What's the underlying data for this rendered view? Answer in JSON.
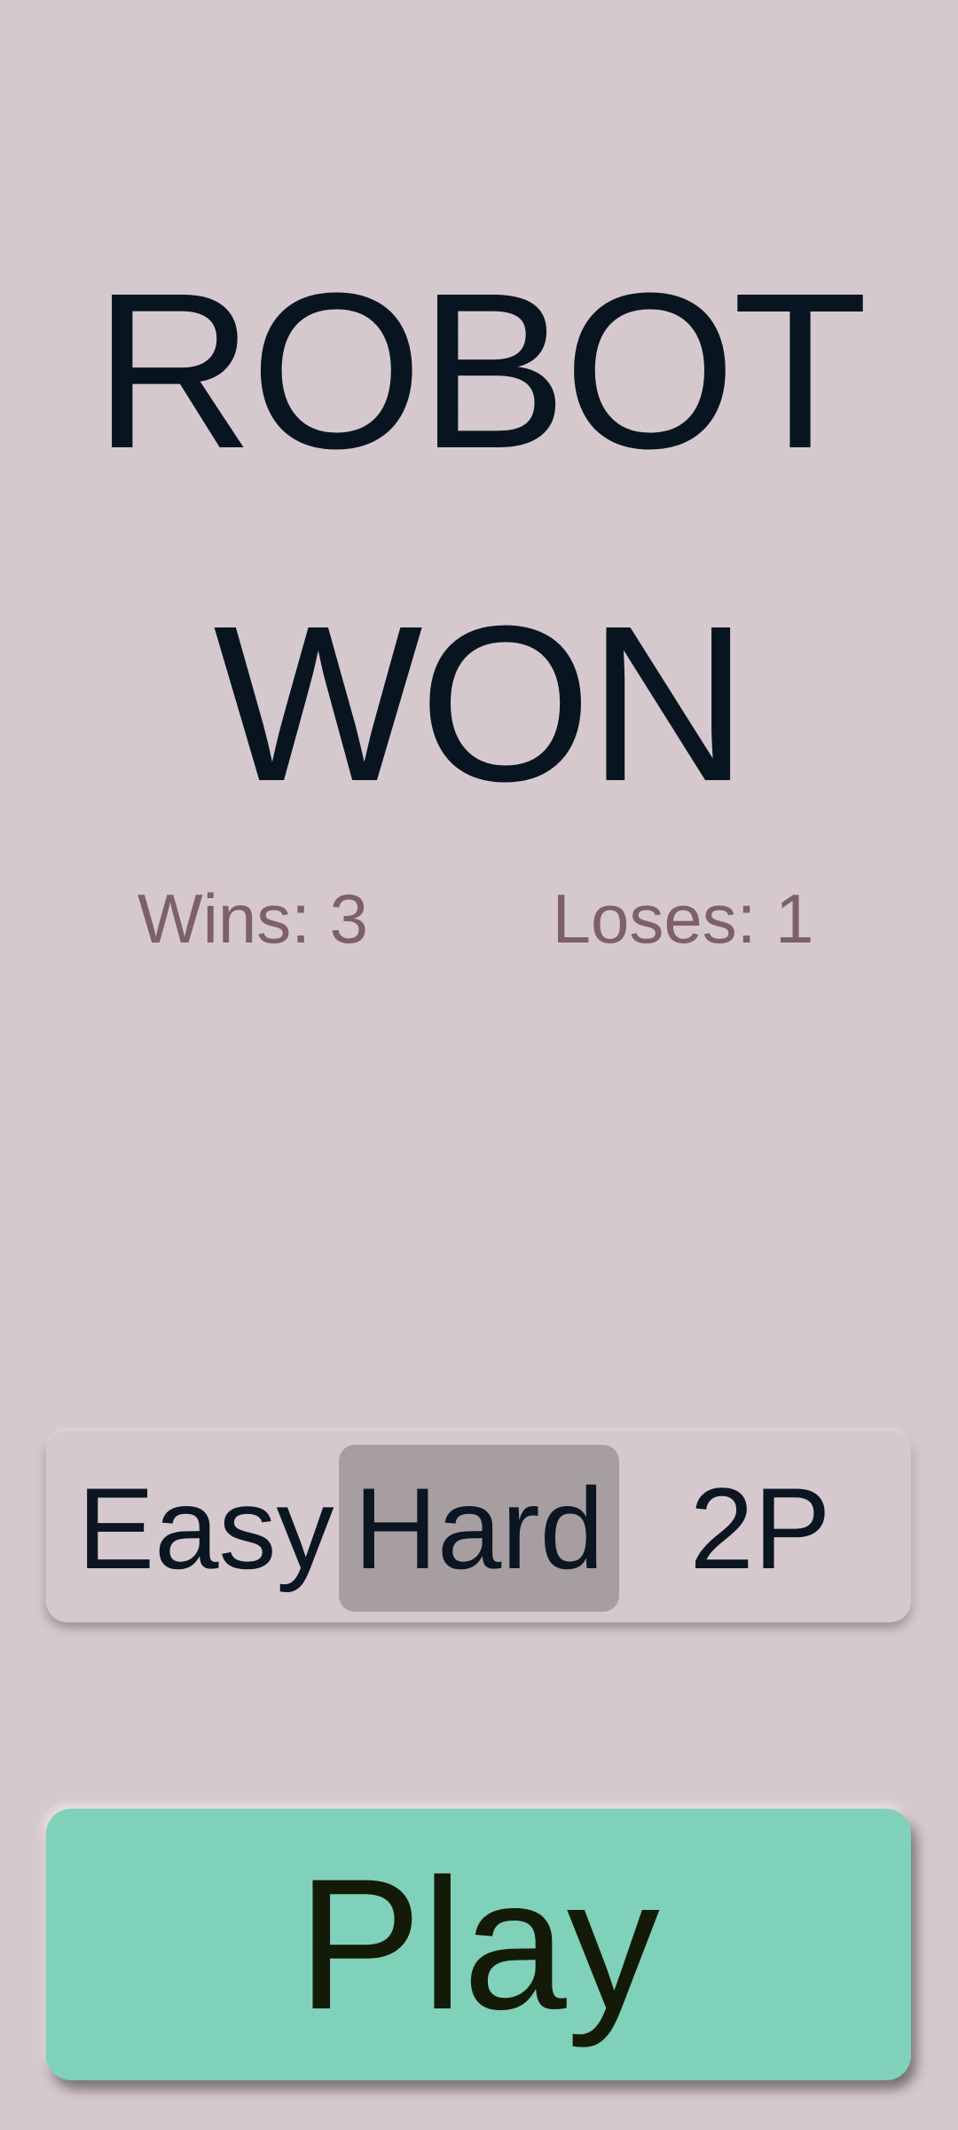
{
  "header": {
    "theme_toggle_icon": "moon-icon"
  },
  "result": {
    "line1": "ROBOT",
    "line2": "WON"
  },
  "stats": {
    "wins": "Wins: 3",
    "loses": "Loses: 1"
  },
  "modes": {
    "options": [
      "Easy",
      "Hard",
      "2P"
    ],
    "selected": "Hard"
  },
  "play_button": {
    "label": "Play"
  },
  "colors": {
    "background": "#d6c9cd",
    "title": "#081520",
    "stats": "#7d6068",
    "selected_mode": "#a69ea1",
    "play_button": "#80d1ba"
  }
}
